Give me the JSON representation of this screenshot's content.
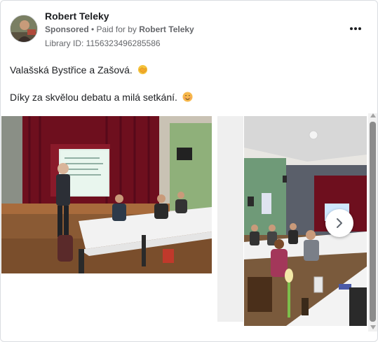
{
  "post": {
    "advertiser_name": "Robert Teleky",
    "sponsored_label": "Sponsored",
    "separator": " • ",
    "paid_for_prefix": "Paid for by ",
    "paid_for_name": "Robert Teleky",
    "library_id": "Library ID: 1156323496285586",
    "body_line1": "Valašská Bystřice a Zašová.",
    "body_line1_emoji": "handshake-emoji",
    "body_line2": "Díky za skvělou debatu a milá setkání.",
    "body_line2_emoji": "smiling-face-emoji"
  },
  "menu": {
    "icon": "more-horizontal-icon"
  },
  "carousel": {
    "slides": [
      {
        "icon": "photo-meeting-stage"
      },
      {
        "icon": "photo-meeting-hall"
      }
    ],
    "next_icon": "chevron-right-icon"
  },
  "colors": {
    "text_primary": "#1c1e21",
    "text_secondary": "#65676b",
    "border": "#dadde1"
  }
}
